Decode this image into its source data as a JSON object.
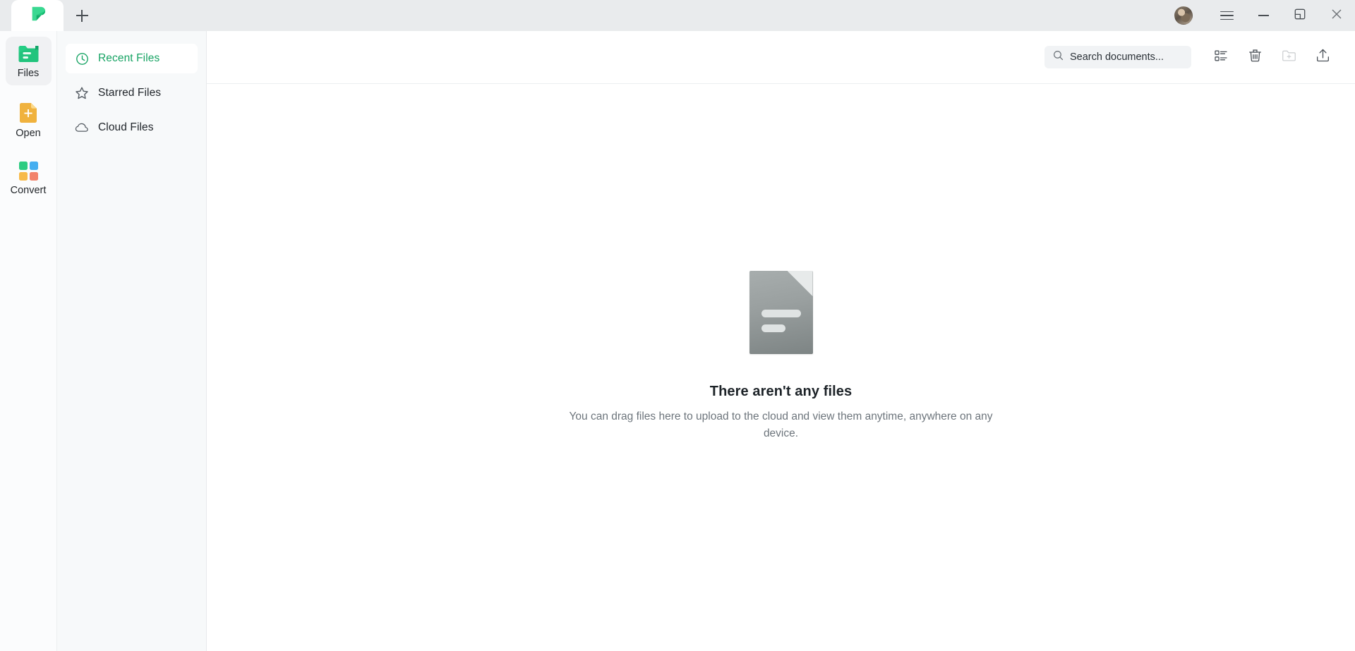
{
  "titlebar": {
    "tab_logo_name": "app-logo-p",
    "new_tab_icon": "plus-icon",
    "avatar_name": "user-avatar",
    "menu_icon": "hamburger-menu-icon",
    "minimize_icon": "minimize-icon",
    "restore_icon": "restore-window-icon",
    "close_icon": "close-icon"
  },
  "rail": {
    "items": [
      {
        "label": "Files",
        "icon": "files-folder-icon",
        "active": true
      },
      {
        "label": "Open",
        "icon": "open-file-plus-icon",
        "active": false
      },
      {
        "label": "Convert",
        "icon": "convert-grid-icon",
        "active": false
      }
    ]
  },
  "nav": {
    "items": [
      {
        "label": "Recent Files",
        "icon": "clock-icon",
        "active": true
      },
      {
        "label": "Starred Files",
        "icon": "star-icon",
        "active": false
      },
      {
        "label": "Cloud Files",
        "icon": "cloud-icon",
        "active": false
      }
    ]
  },
  "toolbar": {
    "search": {
      "value": "Search documents...",
      "placeholder": "Search documents...",
      "icon": "search-icon"
    },
    "buttons": [
      {
        "name": "list-view-icon",
        "label": "List view",
        "disabled": false
      },
      {
        "name": "recycle-bin-icon",
        "label": "Recycle bin",
        "disabled": false
      },
      {
        "name": "new-folder-icon",
        "label": "New folder",
        "disabled": true
      },
      {
        "name": "upload-icon",
        "label": "Upload",
        "disabled": false
      }
    ]
  },
  "empty_state": {
    "illustration": "document-file-icon",
    "title": "There aren't any files",
    "subtitle": "You can drag files here to upload to the cloud and view them anytime, anywhere on any device."
  },
  "colors": {
    "brand_green": "#16a363",
    "titlebar_bg": "#e9ebed",
    "nav_bg": "#f7f9fa",
    "main_bg": "#ffffff",
    "convert_green": "#2ecc82",
    "convert_blue": "#45aef0",
    "convert_yellow": "#f7ba4a",
    "convert_red": "#f2836b",
    "open_yellow": "#f0b23e"
  }
}
